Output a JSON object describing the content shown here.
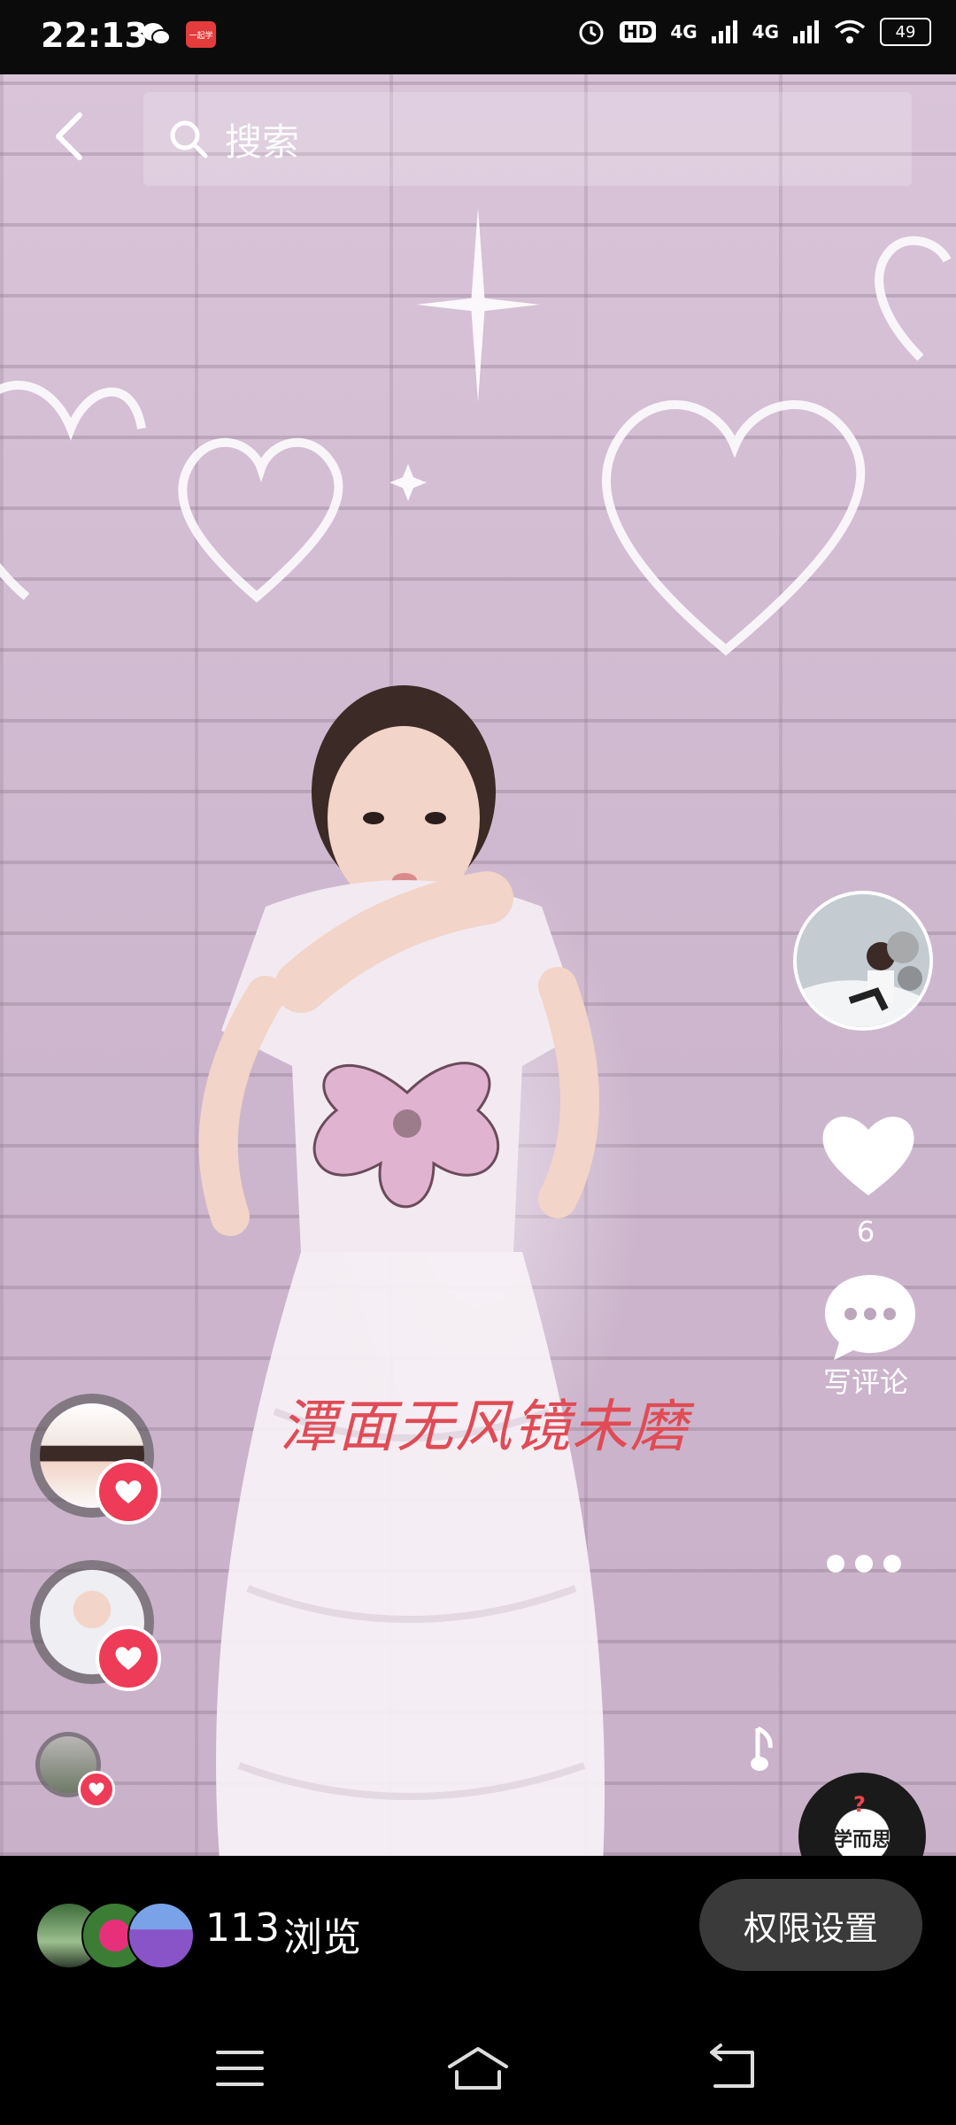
{
  "status_bar": {
    "time": "22:13",
    "app_badge": "一起学",
    "hd_label": "HD",
    "network_1": "4G",
    "network_2": "4G",
    "battery": "49"
  },
  "search": {
    "placeholder": "搜索"
  },
  "video": {
    "caption": "潭面无风镜未磨"
  },
  "actions": {
    "like_count": "6",
    "comment_label": "写评论",
    "music_disc_label": "学而思"
  },
  "bottom": {
    "views_count": "113",
    "views_label": "浏览",
    "permission_button": "权限设置"
  },
  "colors": {
    "accent_heart": "#ee3b58",
    "caption": "#e04b55"
  },
  "icons": [
    "back-icon",
    "search-icon",
    "heart-icon",
    "comment-icon",
    "more-icon",
    "music-note-icon",
    "menu-icon",
    "home-icon",
    "back-nav-icon"
  ]
}
